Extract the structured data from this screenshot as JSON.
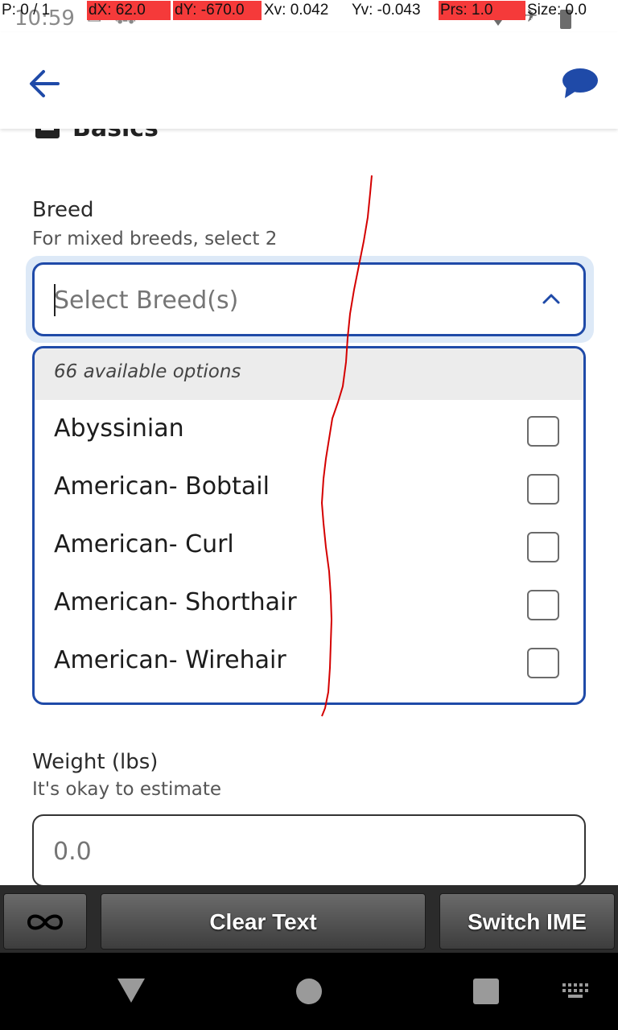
{
  "status_bar": {
    "time": "10:59",
    "notification_icons": [
      "gmail-icon",
      "car-icon"
    ],
    "system_icons": [
      "wifi-icon",
      "airplane-mode-icon",
      "battery-icon"
    ]
  },
  "debug_overlay": {
    "pointer": "P: 0 / 1",
    "dx": "dX: 62.0",
    "dy": "dY: -670.0",
    "xv": "Xv: 0.042",
    "yv": "Yv: -0.043",
    "prs": "Prs: 1.0",
    "size": "Size: 0.0",
    "highlight_color": "#f53a3a"
  },
  "app_bar": {
    "back_icon": "arrow-left-icon",
    "chat_icon": "chat-bubble-icon",
    "accent_color": "#1f4aa8"
  },
  "section": {
    "title": "Basics",
    "icon": "clipboard-icon"
  },
  "breed": {
    "label": "Breed",
    "hint": "For mixed breeds, select 2",
    "placeholder": "Select Breed(s)",
    "value": "",
    "dropdown_header": "66 available options",
    "options": [
      {
        "label": "Abyssinian",
        "checked": false
      },
      {
        "label": "American- Bobtail",
        "checked": false
      },
      {
        "label": "American- Curl",
        "checked": false
      },
      {
        "label": "American- Shorthair",
        "checked": false
      },
      {
        "label": "American- Wirehair",
        "checked": false
      }
    ]
  },
  "weight": {
    "label": "Weight (lbs)",
    "hint": "It's okay to estimate",
    "placeholder": "0.0",
    "value": ""
  },
  "ime_bar": {
    "infinity_icon": "infinity-icon",
    "clear_text": "Clear Text",
    "switch_ime": "Switch IME"
  },
  "nav_bar": {
    "icons": [
      "back-triangle-icon",
      "home-circle-icon",
      "recents-square-icon",
      "keyboard-icon"
    ]
  }
}
